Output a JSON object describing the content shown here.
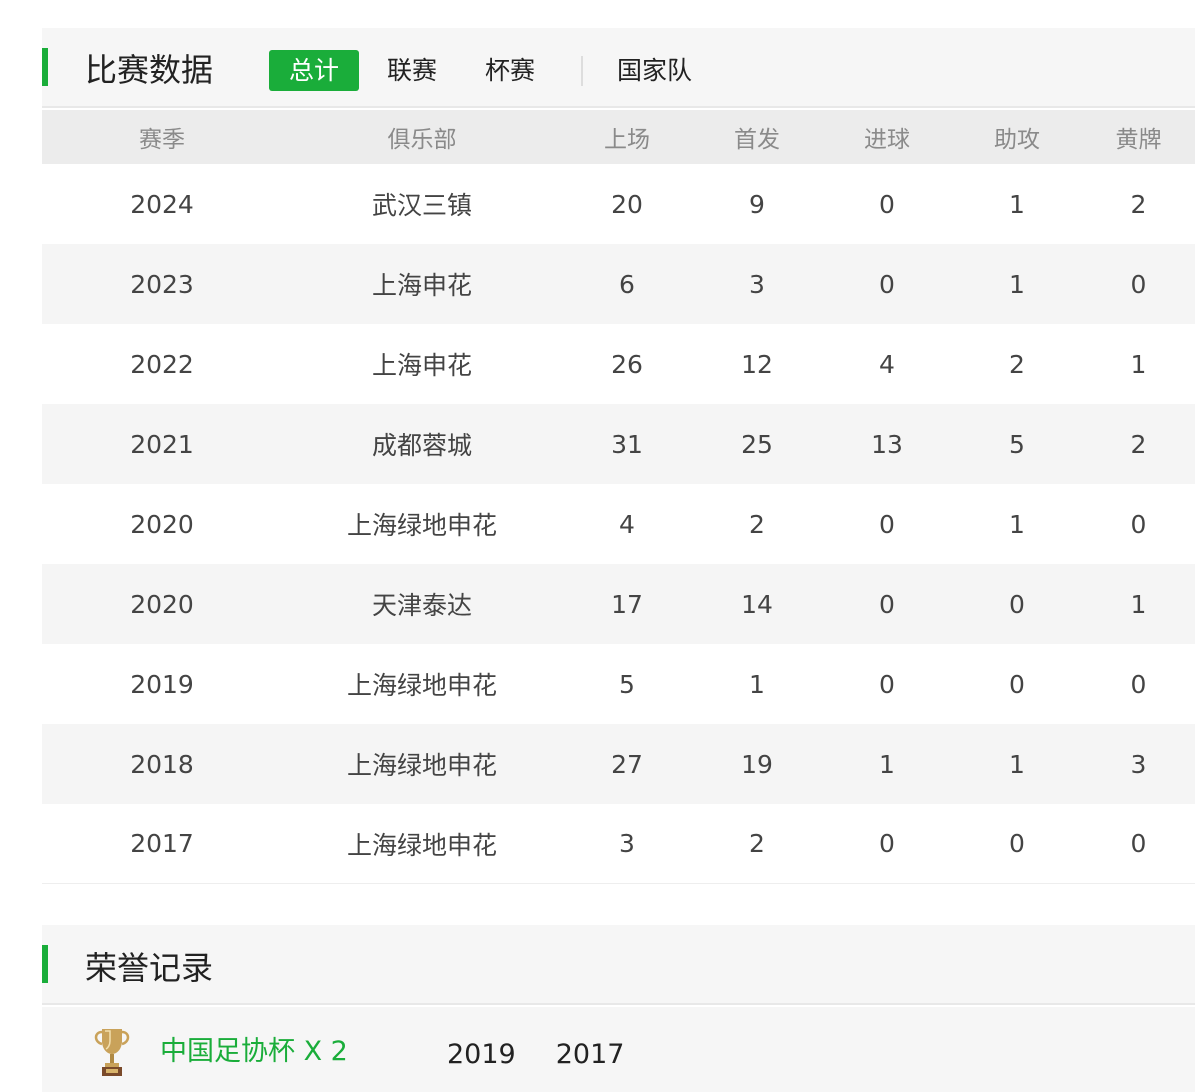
{
  "stats": {
    "title": "比赛数据",
    "tabs": [
      {
        "label": "总计",
        "active": true
      },
      {
        "label": "联赛",
        "active": false
      },
      {
        "label": "杯赛",
        "active": false
      },
      {
        "label": "国家队",
        "active": false
      }
    ],
    "columns": [
      "赛季",
      "俱乐部",
      "上场",
      "首发",
      "进球",
      "助攻",
      "黄牌"
    ],
    "rows": [
      [
        "2024",
        "武汉三镇",
        "20",
        "9",
        "0",
        "1",
        "2"
      ],
      [
        "2023",
        "上海申花",
        "6",
        "3",
        "0",
        "1",
        "0"
      ],
      [
        "2022",
        "上海申花",
        "26",
        "12",
        "4",
        "2",
        "1"
      ],
      [
        "2021",
        "成都蓉城",
        "31",
        "25",
        "13",
        "5",
        "2"
      ],
      [
        "2020",
        "上海绿地申花",
        "4",
        "2",
        "0",
        "1",
        "0"
      ],
      [
        "2020",
        "天津泰达",
        "17",
        "14",
        "0",
        "0",
        "1"
      ],
      [
        "2019",
        "上海绿地申花",
        "5",
        "1",
        "0",
        "0",
        "0"
      ],
      [
        "2018",
        "上海绿地申花",
        "27",
        "19",
        "1",
        "1",
        "3"
      ],
      [
        "2017",
        "上海绿地申花",
        "3",
        "2",
        "0",
        "0",
        "0"
      ]
    ]
  },
  "honors": {
    "title": "荣誉记录",
    "items": [
      {
        "icon": "trophy-icon",
        "name": "中国足协杯 X 2",
        "years": [
          "2019",
          "2017"
        ]
      }
    ]
  },
  "colors": {
    "accent": "#1aad3a",
    "header_bg": "#ececec",
    "stripe_bg": "#f5f5f5"
  }
}
